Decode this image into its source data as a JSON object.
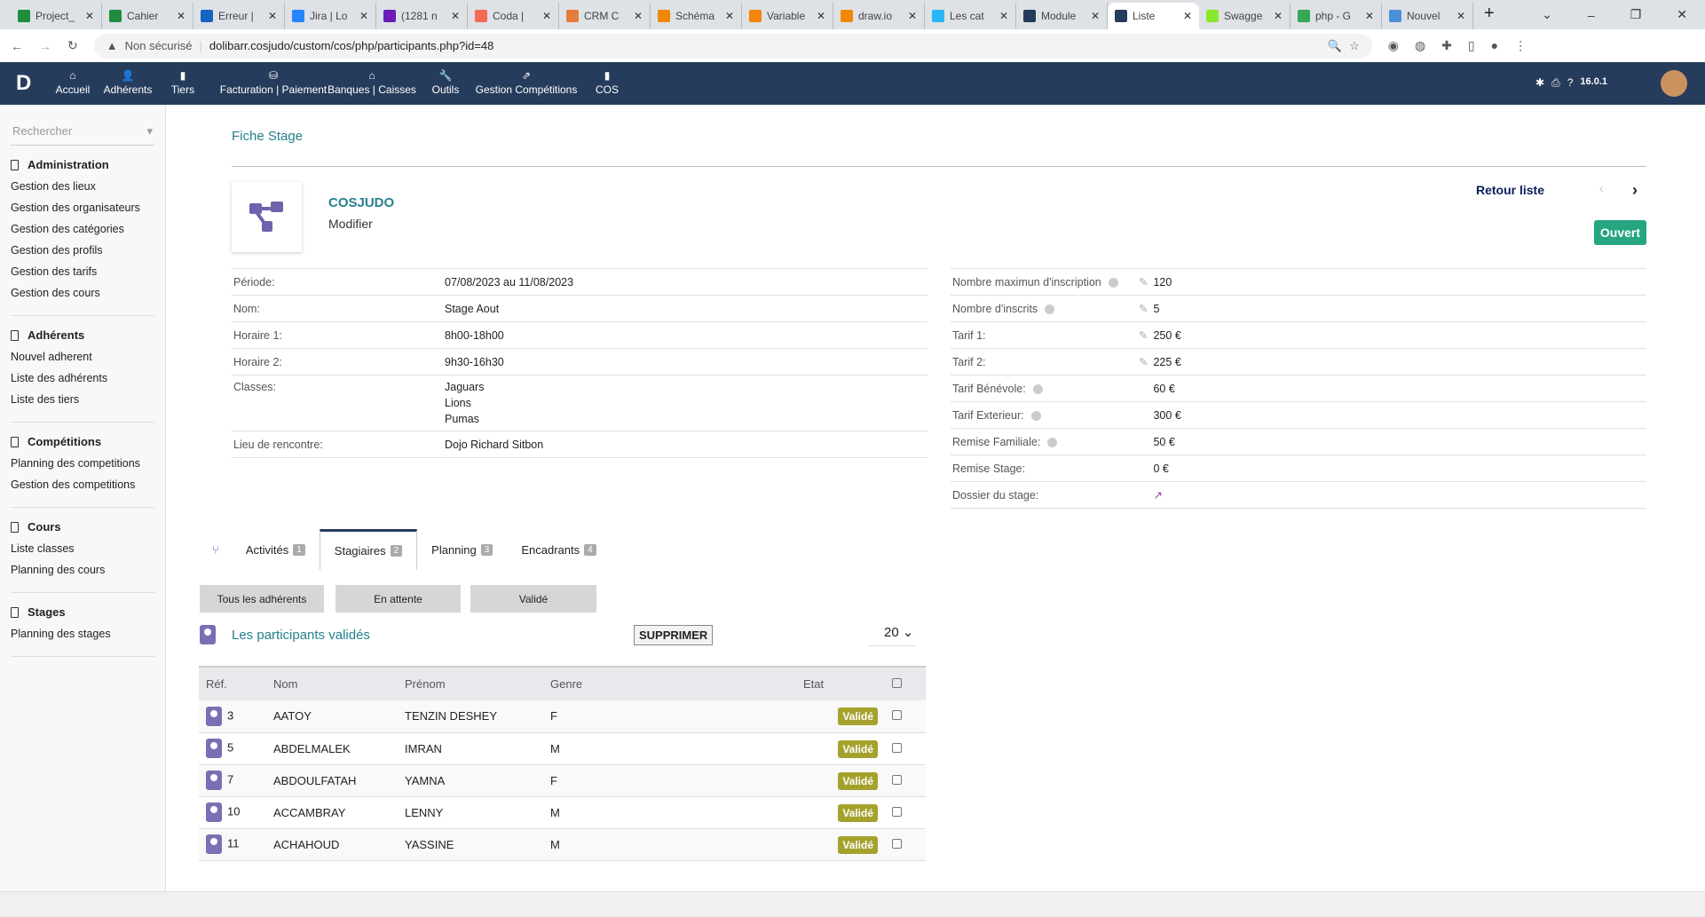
{
  "browser": {
    "tabs": [
      {
        "label": "Project_",
        "color": "#1e8e3e"
      },
      {
        "label": "Cahier",
        "color": "#1e8e3e"
      },
      {
        "label": "Erreur |",
        "color": "#1565c0"
      },
      {
        "label": "Jira | Lo",
        "color": "#2684ff"
      },
      {
        "label": "(1281 n",
        "color": "#6a1bb9"
      },
      {
        "label": "Coda |",
        "color": "#f46a54"
      },
      {
        "label": "CRM C",
        "color": "#e57c3a"
      },
      {
        "label": "Schéma",
        "color": "#f08705"
      },
      {
        "label": "Variable",
        "color": "#f08705"
      },
      {
        "label": "draw.io",
        "color": "#f08705"
      },
      {
        "label": "Les cat",
        "color": "#29b6f6"
      },
      {
        "label": "Module",
        "color": "#263c5c"
      },
      {
        "label": "Liste",
        "color": "#263c5c",
        "active": true
      },
      {
        "label": "Swagge",
        "color": "#85ea2d"
      },
      {
        "label": "php - G",
        "color": "#34a853"
      },
      {
        "label": "Nouvel",
        "color": "#4a90d9"
      }
    ],
    "security": "Non sécurisé",
    "url": "dolibarr.cosjudo/custom/cos/php/participants.php?id=48"
  },
  "topnav": {
    "items": [
      "Accueil",
      "Adhérents",
      "Tiers",
      "Facturation | Paiement",
      "Banques | Caisses",
      "Outils",
      "Gestion Compétitions",
      "COS"
    ],
    "version": "16.0.1"
  },
  "sidebar": {
    "search_placeholder": "Rechercher",
    "groups": [
      {
        "title": "Administration",
        "items": [
          "Gestion des lieux",
          "Gestion des organisateurs",
          "Gestion des catégories",
          "Gestion des profils",
          "Gestion des tarifs",
          "Gestion des cours"
        ]
      },
      {
        "title": "Adhérents",
        "items": [
          "Nouvel adherent",
          "Liste des adhérents",
          "Liste des tiers"
        ]
      },
      {
        "title": "Compétitions",
        "items": [
          "Planning des competitions",
          "Gestion des competitions"
        ]
      },
      {
        "title": "Cours",
        "items": [
          "Liste classes",
          "Planning des cours"
        ]
      },
      {
        "title": "Stages",
        "items": [
          "Planning des stages"
        ]
      }
    ]
  },
  "page": {
    "title": "Fiche Stage",
    "org": "COSJUDO",
    "edit": "Modifier",
    "back": "Retour liste",
    "status": "Ouvert",
    "status_color": "#25a580",
    "left": [
      {
        "label": "Période:",
        "value": "07/08/2023 au 11/08/2023"
      },
      {
        "label": "Nom:",
        "value": "Stage Aout"
      },
      {
        "label": "Horaire 1:",
        "value": "8h00-18h00"
      },
      {
        "label": "Horaire 2:",
        "value": "9h30-16h30"
      },
      {
        "label": "Classes:",
        "value": "Jaguars\nLions\nPumas"
      },
      {
        "label": "Lieu de rencontre:",
        "value": "Dojo Richard Sitbon"
      }
    ],
    "right": [
      {
        "label": "Nombre maximun d'inscription",
        "info": true,
        "edit": true,
        "value": "120"
      },
      {
        "label": "Nombre d'inscrits",
        "info": true,
        "edit": true,
        "value": "5"
      },
      {
        "label": "Tarif 1:",
        "edit": true,
        "value": "250 €"
      },
      {
        "label": "Tarif 2:",
        "edit": true,
        "value": "225 €"
      },
      {
        "label": "Tarif Bénévole:",
        "info": true,
        "value": "60 €"
      },
      {
        "label": "Tarif Exterieur:",
        "info": true,
        "value": "300 €"
      },
      {
        "label": "Remise Familiale:",
        "info": true,
        "value": "50 €"
      },
      {
        "label": "Remise Stage:",
        "value": "0 €"
      },
      {
        "label": "Dossier du stage:",
        "value": "",
        "link": true
      }
    ],
    "tabs": [
      {
        "label": "Activités",
        "badge": "1"
      },
      {
        "label": "Stagiaires",
        "badge": "2",
        "active": true
      },
      {
        "label": "Planning",
        "badge": "3"
      },
      {
        "label": "Encadrants",
        "badge": "4"
      }
    ],
    "filters": [
      "Tous les adhérents",
      "En attente",
      "Validé"
    ],
    "list_title": "Les participants validés",
    "delete": "SUPPRIMER",
    "per_page": "20",
    "columns": [
      "Réf.",
      "Nom",
      "Prénom",
      "Genre",
      "Etat"
    ],
    "rows": [
      [
        "3",
        "AATOY",
        "TENZIN DESHEY",
        "F",
        "Validé"
      ],
      [
        "5",
        "ABDELMALEK",
        "IMRAN",
        "M",
        "Validé"
      ],
      [
        "7",
        "ABDOULFATAH",
        "YAMNA",
        "F",
        "Validé"
      ],
      [
        "10",
        "ACCAMBRAY",
        "LENNY",
        "M",
        "Validé"
      ],
      [
        "11",
        "ACHAHOUD",
        "YASSINE",
        "M",
        "Validé"
      ]
    ]
  }
}
